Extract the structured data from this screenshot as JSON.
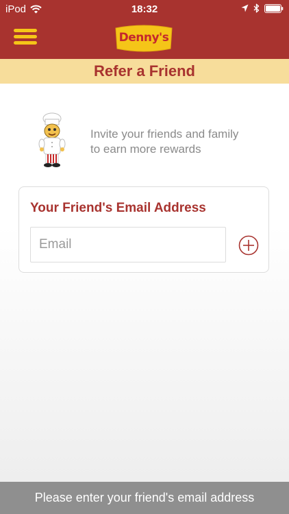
{
  "status_bar": {
    "carrier": "iPod",
    "time": "18:32",
    "icons": [
      "wifi-icon",
      "location-icon",
      "bluetooth-icon",
      "battery-icon"
    ]
  },
  "header": {
    "menu_icon": "hamburger-menu-icon",
    "logo_text": "Denny's"
  },
  "page": {
    "title": "Refer a Friend"
  },
  "intro": {
    "mascot": "chef-mascot-illustration",
    "line1": "Invite your friends and family",
    "line2": "to earn more rewards"
  },
  "form": {
    "title": "Your Friend's Email Address",
    "email_placeholder": "Email",
    "email_value": "",
    "add_icon": "add-circle-icon"
  },
  "footer": {
    "message": "Please enter your friend's email address"
  },
  "colors": {
    "brand_red": "#a8332f",
    "brand_yellow": "#f5c518",
    "title_bar": "#f7dd9b",
    "footer_gray": "#8f8f8f"
  }
}
